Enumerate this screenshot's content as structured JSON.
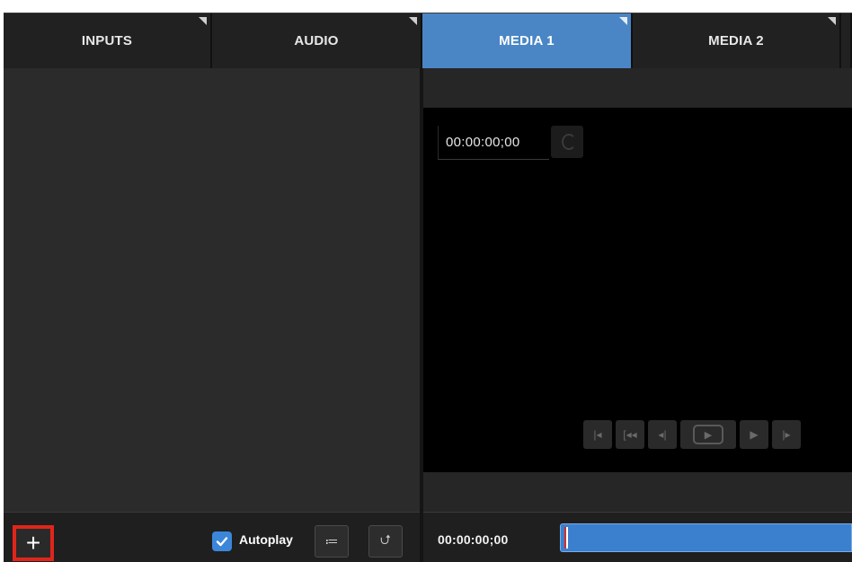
{
  "tabs": [
    {
      "label": "INPUTS",
      "active": false
    },
    {
      "label": "AUDIO",
      "active": false
    },
    {
      "label": "MEDIA 1",
      "active": true
    },
    {
      "label": "MEDIA 2",
      "active": false
    },
    {
      "label": "",
      "active": false
    }
  ],
  "viewer": {
    "timecode": "00:00:00;00"
  },
  "bottom_left": {
    "add_label": "+",
    "autoplay_label": "Autoplay",
    "autoplay_checked": true,
    "playlist_icon": "≔",
    "loop_icon": "⮍"
  },
  "bottom_right": {
    "timecode": "00:00:00;00",
    "scrub_fill_color": "#3b7fcf"
  },
  "colors": {
    "accent": "#4a86c5",
    "highlight": "#e0251a"
  }
}
